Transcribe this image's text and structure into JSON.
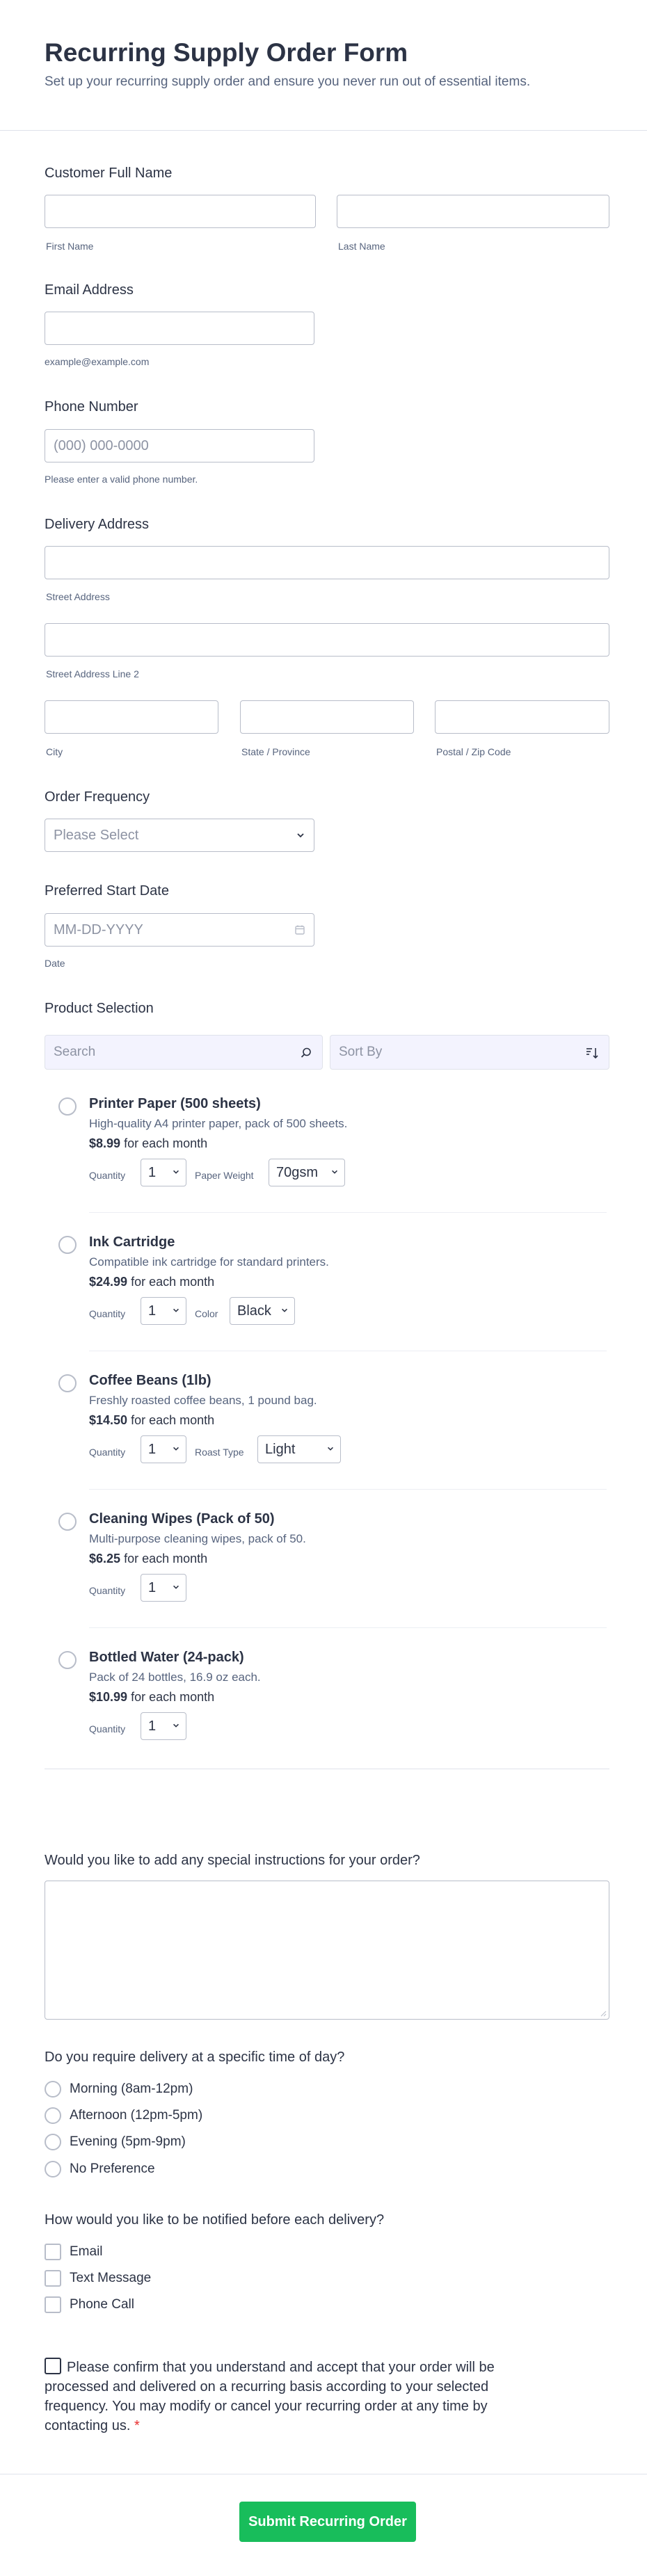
{
  "form": {
    "title": "Recurring Supply Order Form",
    "subtitle": "Set up your recurring supply order and ensure you never run out of essential items."
  },
  "name": {
    "label": "Customer Full Name",
    "first": "First Name",
    "last": "Last Name"
  },
  "email": {
    "label": "Email Address",
    "hint": "example@example.com"
  },
  "phone": {
    "label": "Phone Number",
    "placeholder": "(000) 000-0000",
    "hint": "Please enter a valid phone number."
  },
  "address": {
    "label": "Delivery Address",
    "street": "Street Address",
    "street2": "Street Address Line 2",
    "city": "City",
    "state": "State / Province",
    "zip": "Postal / Zip Code"
  },
  "frequency": {
    "label": "Order Frequency",
    "placeholder": "Please Select"
  },
  "start_date": {
    "label": "Preferred Start Date",
    "placeholder": "MM-DD-YYYY",
    "hint": "Date"
  },
  "products": {
    "label": "Product Selection",
    "search_placeholder": "Search",
    "sort_placeholder": "Sort By",
    "quantity_label": "Quantity",
    "items": [
      {
        "name": "Printer Paper (500 sheets)",
        "desc": "High-quality A4 printer paper, pack of 500 sheets.",
        "price": "$8.99",
        "per": "for each month",
        "qty": "1",
        "opt_label": "Paper Weight",
        "opt_value": "70gsm"
      },
      {
        "name": "Ink Cartridge",
        "desc": "Compatible ink cartridge for standard printers.",
        "price": "$24.99",
        "per": "for each month",
        "qty": "1",
        "opt_label": "Color",
        "opt_value": "Black"
      },
      {
        "name": "Coffee Beans (1lb)",
        "desc": "Freshly roasted coffee beans, 1 pound bag.",
        "price": "$14.50",
        "per": "for each month",
        "qty": "1",
        "opt_label": "Roast Type",
        "opt_value": "Light"
      },
      {
        "name": "Cleaning Wipes (Pack of 50)",
        "desc": "Multi-purpose cleaning wipes, pack of 50.",
        "price": "$6.25",
        "per": "for each month",
        "qty": "1"
      },
      {
        "name": "Bottled Water (24-pack)",
        "desc": "Pack of 24 bottles, 16.9 oz each.",
        "price": "$10.99",
        "per": "for each month",
        "qty": "1"
      }
    ]
  },
  "instructions": {
    "label": "Would you like to add any special instructions for your order?"
  },
  "delivery_time": {
    "label": "Do you require delivery at a specific time of day?",
    "options": [
      "Morning (8am-12pm)",
      "Afternoon (12pm-5pm)",
      "Evening (5pm-9pm)",
      "No Preference"
    ]
  },
  "notify": {
    "label": "How would you like to be notified before each delivery?",
    "options": [
      "Email",
      "Text Message",
      "Phone Call"
    ]
  },
  "consent": {
    "text": "Please confirm that you understand and accept that your order will be processed and delivered on a recurring basis according to your selected frequency. You may modify or cancel your recurring order at any time by contacting us.",
    "required_mark": "*"
  },
  "submit": {
    "label": "Submit Recurring Order",
    "color": "#18bd5b"
  }
}
